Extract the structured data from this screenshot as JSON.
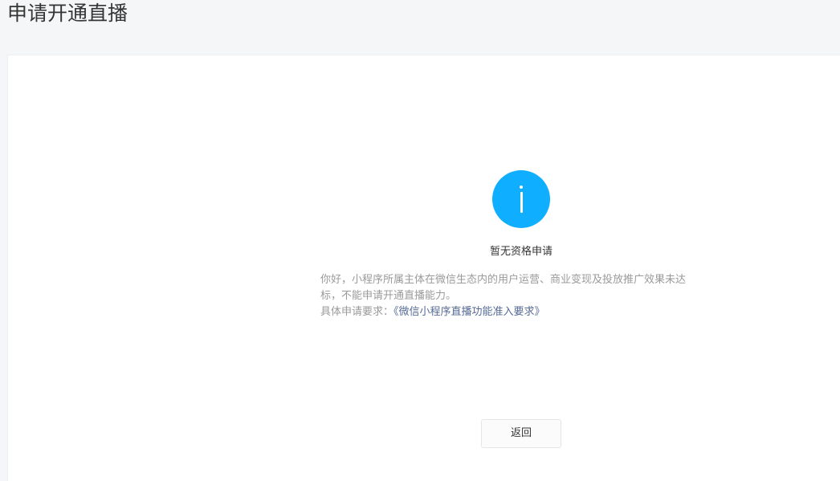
{
  "page": {
    "title": "申请开通直播"
  },
  "status": {
    "icon": "info-icon",
    "icon_color": "#10aeff",
    "title": "暂无资格申请",
    "description_line1": "你好，小程序所属主体在微信生态内的用户运营、商业变现及投放推广效果未达",
    "description_line2": "标，不能申请开通直播能力。",
    "requirement_label": "具体申请要求：",
    "requirement_link": "《微信小程序直播功能准入要求》",
    "link_color": "#576b95"
  },
  "actions": {
    "back_label": "返回"
  }
}
